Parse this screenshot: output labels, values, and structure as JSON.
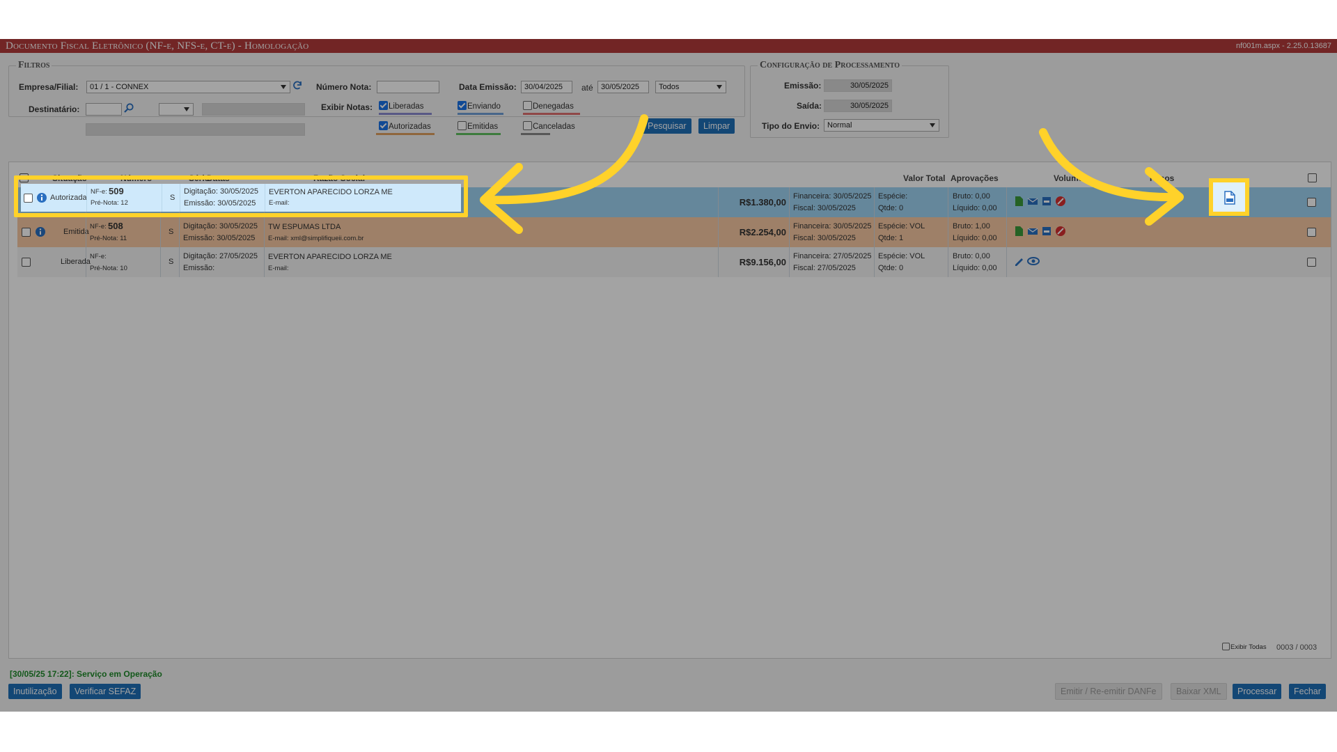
{
  "window": {
    "title": "Documento Fiscal Eletrônico (NF-e, NFS-e, CT-e) - Homologação",
    "version": "nf001m.aspx - 2.25.0.13687"
  },
  "filters": {
    "legend": "Filtros",
    "empresa_label": "Empresa/Filial:",
    "empresa_value": "01 / 1 - CONNEX",
    "destinatario_label": "Destinatário:",
    "numero_nota_label": "Número Nota:",
    "data_emissao_label": "Data Emissão:",
    "data_inicio": "30/04/2025",
    "ate_label": "até",
    "data_fim": "30/05/2025",
    "tipo_value": "Todos",
    "exibir_label": "Exibir Notas:",
    "checks": [
      {
        "label": "Liberadas",
        "checked": true,
        "color": "#8a8ad0"
      },
      {
        "label": "Enviando",
        "checked": true,
        "color": "#6fa0d8"
      },
      {
        "label": "Denegadas",
        "checked": false,
        "color": "#e07070"
      },
      {
        "label": "Autorizadas",
        "checked": true,
        "color": "#e0a060"
      },
      {
        "label": "Emitidas",
        "checked": false,
        "color": "#60c060"
      },
      {
        "label": "Canceladas",
        "checked": false,
        "color": "#888888"
      }
    ],
    "pesquisar": "Pesquisar",
    "limpar": "Limpar"
  },
  "config": {
    "legend": "Configuração de Processamento",
    "emissao_label": "Emissão:",
    "emissao_value": "30/05/2025",
    "saida_label": "Saída:",
    "saida_value": "30/05/2025",
    "tipo_envio_label": "Tipo do Envio:",
    "tipo_envio_value": "Normal"
  },
  "grid": {
    "headers": [
      "Situação",
      "Número",
      "Série",
      "Datas",
      "Razão Social",
      "Valor Total",
      "Aprovações",
      "Volume",
      "Pesos"
    ],
    "rows": [
      {
        "situacao": "Autorizada",
        "nfe_label": "NF-e:",
        "numero": "509",
        "pre_nota": "Pré-Nota: 12",
        "serie": "S",
        "digitacao": "Digitação: 30/05/2025",
        "emissao": "Emissão: 30/05/2025",
        "razao": "EVERTON APARECIDO LORZA ME",
        "email": "E-mail:",
        "valor": "R$1.380,00",
        "aprov1": "Financeira: 30/05/2025",
        "aprov2": "Fiscal: 30/05/2025",
        "vol1": "Espécie:",
        "vol2": "Qtde: 0",
        "peso1": "Bruto: 0,00",
        "peso2": "Líquido: 0,00",
        "bg": "#9fd3f3"
      },
      {
        "situacao": "Emitida",
        "nfe_label": "NF-e:",
        "numero": "508",
        "pre_nota": "Pré-Nota: 11",
        "serie": "S",
        "digitacao": "Digitação: 30/05/2025",
        "emissao": "Emissão: 30/05/2025",
        "razao": "TW ESPUMAS LTDA",
        "email": "E-mail: xml@simplifiqueii.com.br",
        "valor": "R$2.254,00",
        "aprov1": "Financeira: 30/05/2025",
        "aprov2": "Fiscal: 30/05/2025",
        "vol1": "Espécie: VOL",
        "vol2": "Qtde: 1",
        "peso1": "Bruto: 1,00",
        "peso2": "Líquido: 0,00",
        "bg": "#f7c9a3"
      },
      {
        "situacao": "Liberada",
        "nfe_label": "NF-e:",
        "numero": "",
        "pre_nota": "Pré-Nota: 10",
        "serie": "S",
        "digitacao": "Digitação: 27/05/2025",
        "emissao": "Emissão:",
        "razao": "EVERTON APARECIDO LORZA ME",
        "email": "E-mail:",
        "valor": "R$9.156,00",
        "aprov1": "Financeira: 27/05/2025",
        "aprov2": "Fiscal: 27/05/2025",
        "vol1": "Espécie: VOL",
        "vol2": "Qtde: 0",
        "peso1": "Bruto: 0,00",
        "peso2": "Líquido: 0,00",
        "bg": "#f4f4f4"
      }
    ],
    "exibir_todas": "Exibir Todas",
    "count": "0003 / 0003"
  },
  "status": "[30/05/25 17:22]: Serviço em Operação",
  "buttons": {
    "inutilizacao": "Inutilização",
    "verificar": "Verificar SEFAZ",
    "emitir": "Emitir / Re-emitir DANFe",
    "baixar": "Baixar XML",
    "processar": "Processar",
    "fechar": "Fechar"
  },
  "accent": "#ffd22a"
}
